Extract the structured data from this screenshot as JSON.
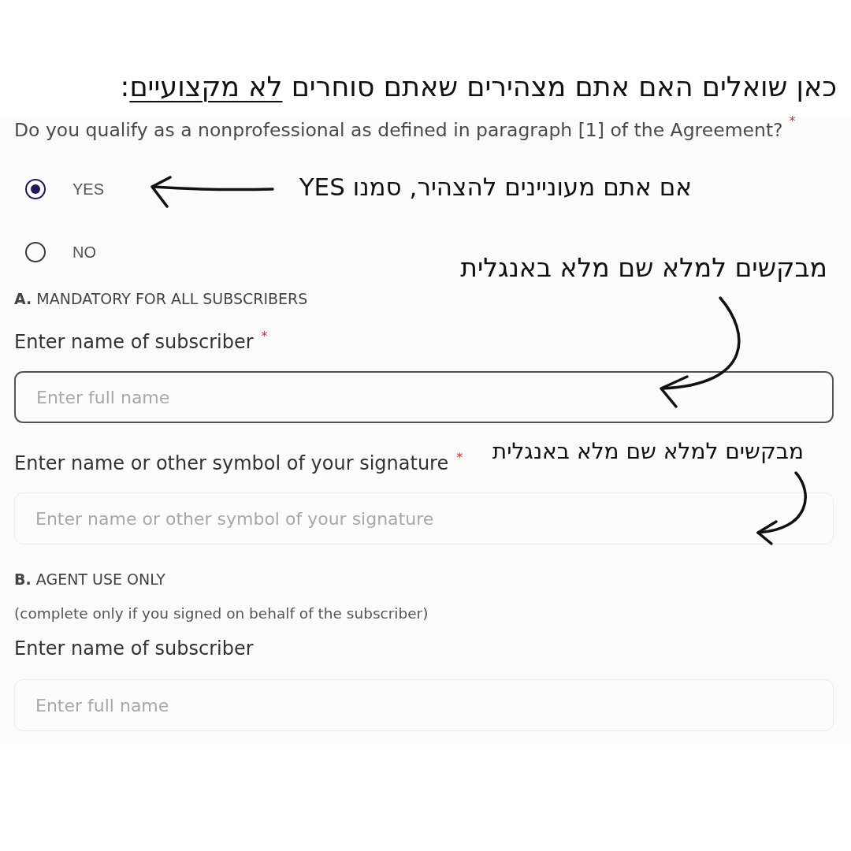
{
  "heading": {
    "parts": [
      {
        "text": "כאן שואלים האם אתם מצהירים שאתם סוחרים ",
        "underlined": false
      },
      {
        "text": "לא מקצועיים",
        "underlined": true
      },
      {
        "text": ":",
        "underlined": false
      }
    ]
  },
  "form": {
    "question": {
      "text": "Do you qualify as a nonprofessional as defined in paragraph [1] of the Agreement?",
      "required_mark": "*"
    },
    "options": [
      {
        "label": "YES",
        "selected": true
      },
      {
        "label": "NO",
        "selected": false
      }
    ],
    "section_a": {
      "title": "**A.** MANDATORY FOR ALL SUBSCRIBERS",
      "fields": [
        {
          "label": "Enter name of subscriber",
          "required_mark": "*",
          "placeholder": "Enter full name",
          "focused": true
        },
        {
          "label": "Enter name or other symbol of your signature",
          "required_mark": "*",
          "placeholder": "Enter name or other symbol of your signature",
          "focused": false
        }
      ]
    },
    "section_b": {
      "title": "**B.** AGENT USE ONLY",
      "note": "(complete only if you signed on behalf of the subscriber)",
      "fields": [
        {
          "label": "Enter name of subscriber",
          "placeholder": "Enter full name",
          "focused": false
        }
      ]
    }
  },
  "annotations": [
    {
      "text": "אם אתם מעוניינים להצהיר, סמנו YES"
    },
    {
      "text": "מבקשים למלא שם מלא באנגלית"
    },
    {
      "text": "מבקשים למלא שם מלא באנגלית"
    }
  ]
}
